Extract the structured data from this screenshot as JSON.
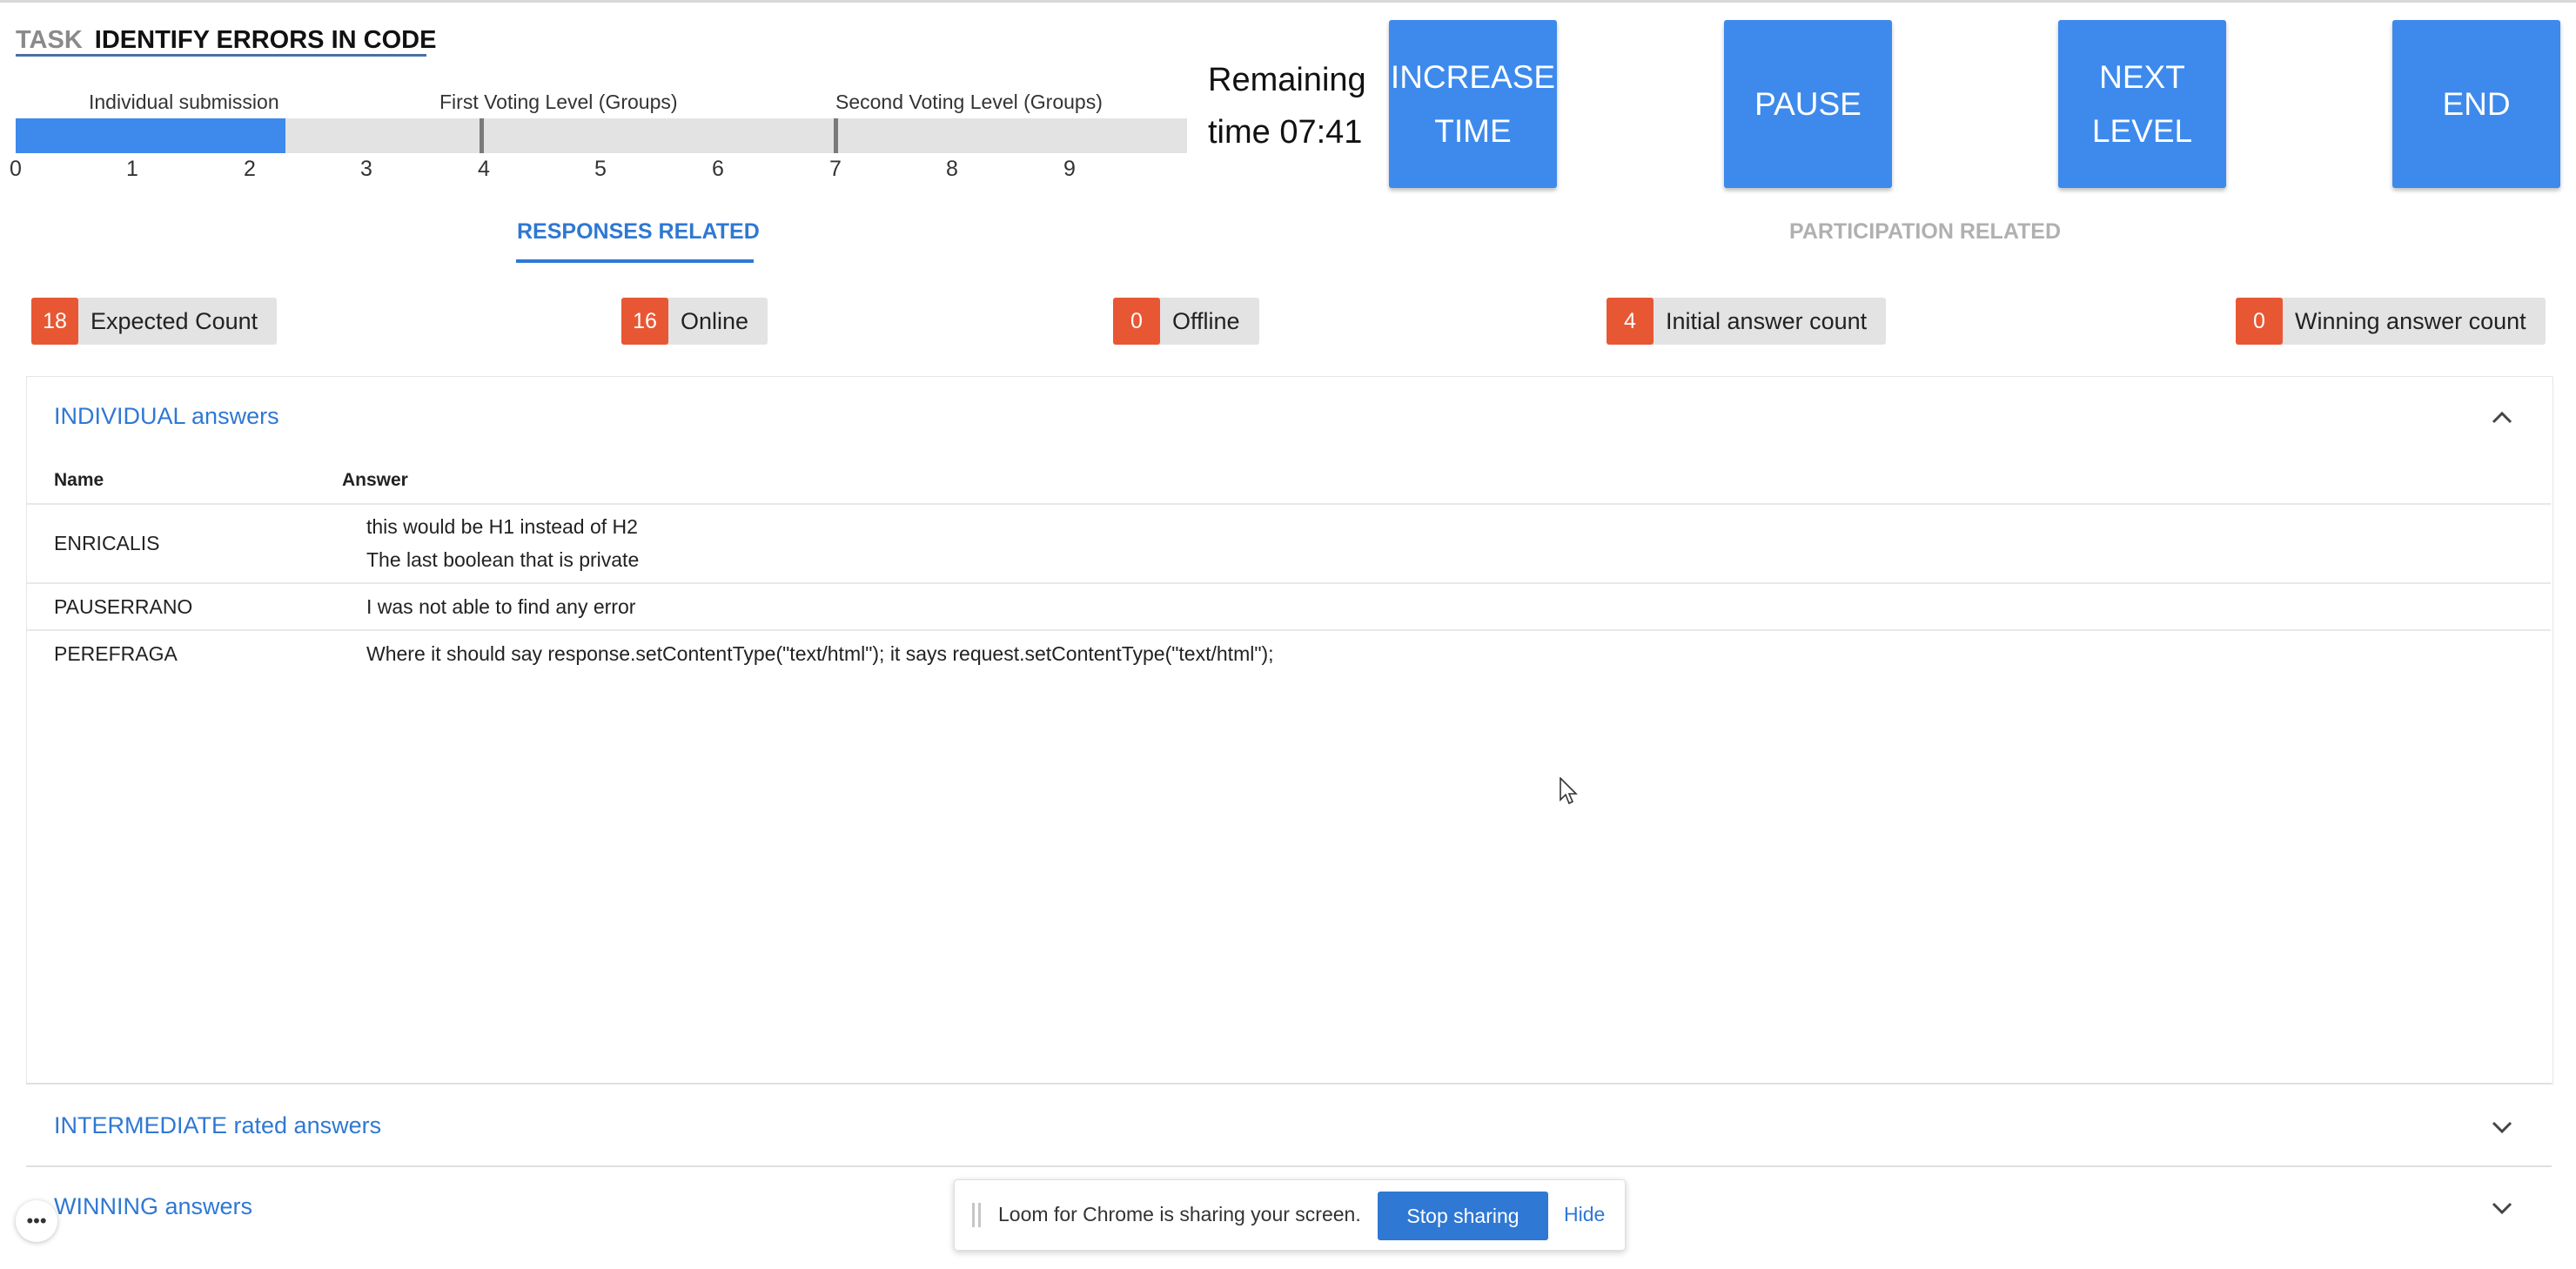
{
  "task": {
    "label": "TASK",
    "name": "IDENTIFY ERRORS IN CODE"
  },
  "progress": {
    "stages": [
      "Individual submission",
      "First Voting Level (Groups)",
      "Second Voting Level (Groups)"
    ],
    "ticks": [
      "0",
      "1",
      "2",
      "3",
      "4",
      "5",
      "6",
      "7",
      "8",
      "9"
    ],
    "current_value": 2.3
  },
  "timer": {
    "line1": "Remaining",
    "line2": "time 07:41"
  },
  "actions": {
    "increase_time": "INCREASE\nTIME",
    "pause": "PAUSE",
    "next_level": "NEXT\nLEVEL",
    "end": "END"
  },
  "tabs": {
    "responses": "RESPONSES RELATED",
    "participation": "PARTICIPATION RELATED"
  },
  "stats": [
    {
      "count": "18",
      "label": "Expected Count"
    },
    {
      "count": "16",
      "label": "Online"
    },
    {
      "count": "0",
      "label": "Offline"
    },
    {
      "count": "4",
      "label": "Initial answer count"
    },
    {
      "count": "0",
      "label": "Winning answer count"
    }
  ],
  "individual": {
    "title": "INDIVIDUAL answers",
    "col_name": "Name",
    "col_answer": "Answer",
    "rows": [
      {
        "name": "ENRICALIS",
        "answer_lines": [
          "this would be H1 instead of H2",
          "The last boolean that is private"
        ]
      },
      {
        "name": "PAUSERRANO",
        "answer_lines": [
          "I was not able to find any error"
        ]
      },
      {
        "name": "PEREFRAGA",
        "answer_lines": [
          "Where it should say response.setContentType(\"text/html\"); it says request.setContentType(\"text/html\");"
        ]
      }
    ]
  },
  "intermediate": {
    "title": "INTERMEDIATE rated answers"
  },
  "winning": {
    "title": "WINNING answers"
  },
  "loom": {
    "message": "Loom for Chrome is sharing your screen.",
    "stop": "Stop sharing",
    "hide": "Hide"
  },
  "colors": {
    "accent": "#3d8aec",
    "badge": "#e85733",
    "link": "#2f78d3"
  }
}
